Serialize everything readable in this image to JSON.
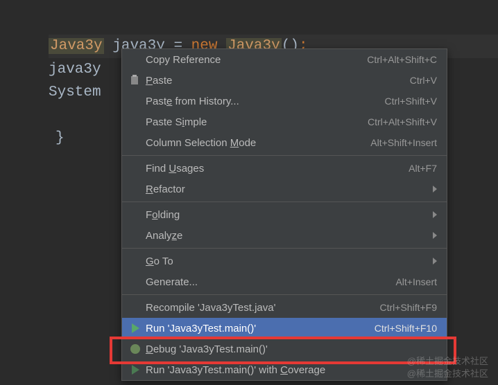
{
  "code": {
    "line1": {
      "type1": "Java3y",
      "ident": "java3y",
      "op": " = ",
      "kw": "new",
      "type2": "Java3y",
      "paren": "()",
      "semi": ";"
    },
    "line2": "java3y",
    "line3": "System",
    "brace": "}"
  },
  "menu": {
    "copyReference": {
      "label": "Copy Reference",
      "shortcut": "Ctrl+Alt+Shift+C"
    },
    "paste": {
      "underline": "P",
      "rest": "aste",
      "shortcut": "Ctrl+V"
    },
    "pasteHistory": {
      "pre": "Past",
      "underline": "e",
      "rest": " from History...",
      "shortcut": "Ctrl+Shift+V"
    },
    "pasteSimple": {
      "pre": "Paste S",
      "underline": "i",
      "rest": "mple",
      "shortcut": "Ctrl+Alt+Shift+V"
    },
    "columnSelection": {
      "pre": "Column Selection ",
      "underline": "M",
      "rest": "ode",
      "shortcut": "Alt+Shift+Insert"
    },
    "findUsages": {
      "pre": "Find ",
      "underline": "U",
      "rest": "sages",
      "shortcut": "Alt+F7"
    },
    "refactor": {
      "underline": "R",
      "rest": "efactor"
    },
    "folding": {
      "pre": "F",
      "underline": "o",
      "rest": "lding"
    },
    "analyze": {
      "pre": "Analy",
      "underline": "z",
      "rest": "e"
    },
    "goto": {
      "underline": "G",
      "rest": "o To"
    },
    "generate": {
      "label": "Generate...",
      "shortcut": "Alt+Insert"
    },
    "recompile": {
      "label": "Recompile 'Java3yTest.java'",
      "shortcut": "Ctrl+Shift+F9"
    },
    "run": {
      "label": "Run 'Java3yTest.main()'",
      "shortcut": "Ctrl+Shift+F10"
    },
    "debug": {
      "underline": "D",
      "rest": "ebug 'Java3yTest.main()'"
    },
    "runCoverage": {
      "pre": "Run 'Java3yTest.main()' with ",
      "underline": "C",
      "rest": "overage"
    }
  },
  "watermark1": "@稀土掘金技术社区",
  "watermark2": "@稀土掘金技术社区"
}
